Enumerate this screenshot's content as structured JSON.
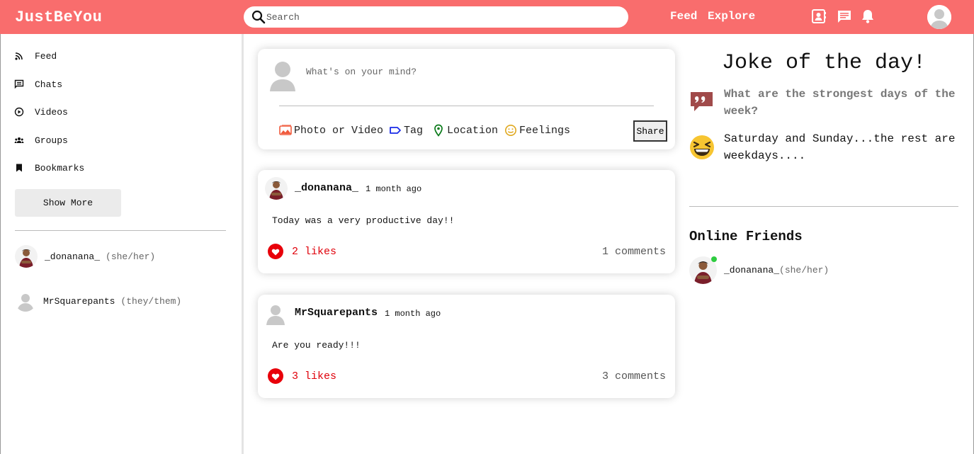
{
  "app": {
    "brand": "JustBeYou"
  },
  "topbar": {
    "search_placeholder": "Search",
    "links": [
      "Feed",
      "Explore"
    ],
    "icons": [
      "contact-book-icon",
      "chat-icon",
      "bell-icon",
      "profile-avatar"
    ],
    "color": "#f96d6d"
  },
  "sidebar": {
    "items": [
      {
        "label": "Feed",
        "icon": "rss-icon"
      },
      {
        "label": "Chats",
        "icon": "chat-icon"
      },
      {
        "label": "Videos",
        "icon": "play-circle-icon"
      },
      {
        "label": "Groups",
        "icon": "groups-icon"
      },
      {
        "label": "Bookmarks",
        "icon": "bookmark-icon"
      }
    ],
    "show_more": "Show More",
    "friends": [
      {
        "name": "_donanana_",
        "pronouns": "(she/her)"
      },
      {
        "name": "MrSquarepants",
        "pronouns": "(they/them)"
      }
    ]
  },
  "composer": {
    "placeholder": "What's on your mind?",
    "options": [
      {
        "label": "Photo or Video",
        "icon": "photo-icon",
        "color": "#f05a3c"
      },
      {
        "label": "Tag",
        "icon": "tag-icon",
        "color": "#1a2be8"
      },
      {
        "label": "Location",
        "icon": "location-pin-icon",
        "color": "#0a7a1a"
      },
      {
        "label": "Feelings",
        "icon": "smile-icon",
        "color": "#e0a81e"
      }
    ],
    "share": "Share"
  },
  "posts": [
    {
      "author": "_donanana_",
      "time": "1 month ago",
      "text": "Today was a very productive day!!",
      "likes": "2 likes",
      "comments": "1 comments"
    },
    {
      "author": "MrSquarepants",
      "time": "1 month ago",
      "text": "Are you ready!!!",
      "likes": "3 likes",
      "comments": "3 comments"
    }
  ],
  "joke": {
    "title": "Joke of the day!",
    "question": "What are the strongest days of the week?",
    "answer": "Saturday and Sunday...the rest are weekdays...."
  },
  "online": {
    "title": "Online Friends",
    "friends": [
      {
        "name": "_donanana_",
        "pronouns": "(she/her)"
      }
    ]
  }
}
